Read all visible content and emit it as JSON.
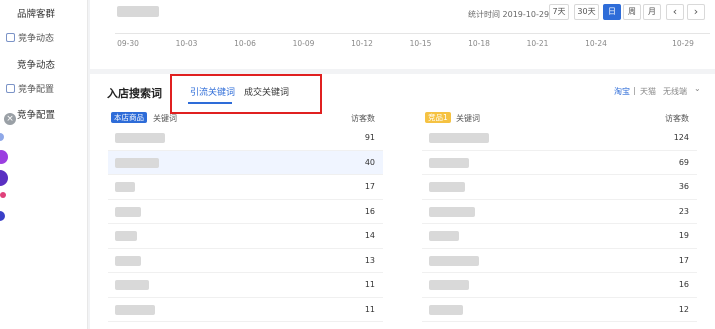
{
  "sidebar": {
    "items": [
      {
        "label": "品牌客群"
      },
      {
        "label": "竞争动态"
      },
      {
        "label": "竞争动态"
      },
      {
        "label": "竞争配置"
      },
      {
        "label": "竞争配置"
      }
    ]
  },
  "top_panel": {
    "stat_time": "统计时间 2019-10-29",
    "range_buttons": [
      {
        "label": "7天"
      },
      {
        "label": "30天"
      },
      {
        "label": "日"
      },
      {
        "label": "周"
      },
      {
        "label": "月"
      }
    ],
    "prev_label": "‹",
    "next_label": "›",
    "x_ticks": [
      "09-30",
      "10-03",
      "10-06",
      "10-09",
      "10-12",
      "10-15",
      "10-18",
      "10-21",
      "10-24",
      "10-29"
    ]
  },
  "search_panel": {
    "title": "入店搜索词",
    "tabs": [
      {
        "label": "引流关键词",
        "active": true
      },
      {
        "label": "成交关键词",
        "active": false
      }
    ],
    "platform": {
      "taobao": "淘宝",
      "separator": "|",
      "tmall": "天猫",
      "device": "无线端",
      "device_caret": "⌄"
    },
    "left_table": {
      "badge": "本店商品",
      "keyword_header": "关键词",
      "count_header": "访客数",
      "rows": [
        {
          "count": "91"
        },
        {
          "count": "40"
        },
        {
          "count": "17"
        },
        {
          "count": "16"
        },
        {
          "count": "14"
        },
        {
          "count": "13"
        },
        {
          "count": "11"
        },
        {
          "count": "11"
        }
      ]
    },
    "right_table": {
      "badge": "竞品1",
      "keyword_header": "关键词",
      "count_header": "访客数",
      "rows": [
        {
          "count": "124"
        },
        {
          "count": "69"
        },
        {
          "count": "36"
        },
        {
          "count": "23"
        },
        {
          "count": "19"
        },
        {
          "count": "17"
        },
        {
          "count": "16"
        },
        {
          "count": "12"
        }
      ]
    }
  },
  "colors": {
    "accent": "#2e6cd8",
    "highlight_box": "#e02020",
    "badge_left": "#2e6cd8",
    "badge_right": "#f5c242"
  }
}
